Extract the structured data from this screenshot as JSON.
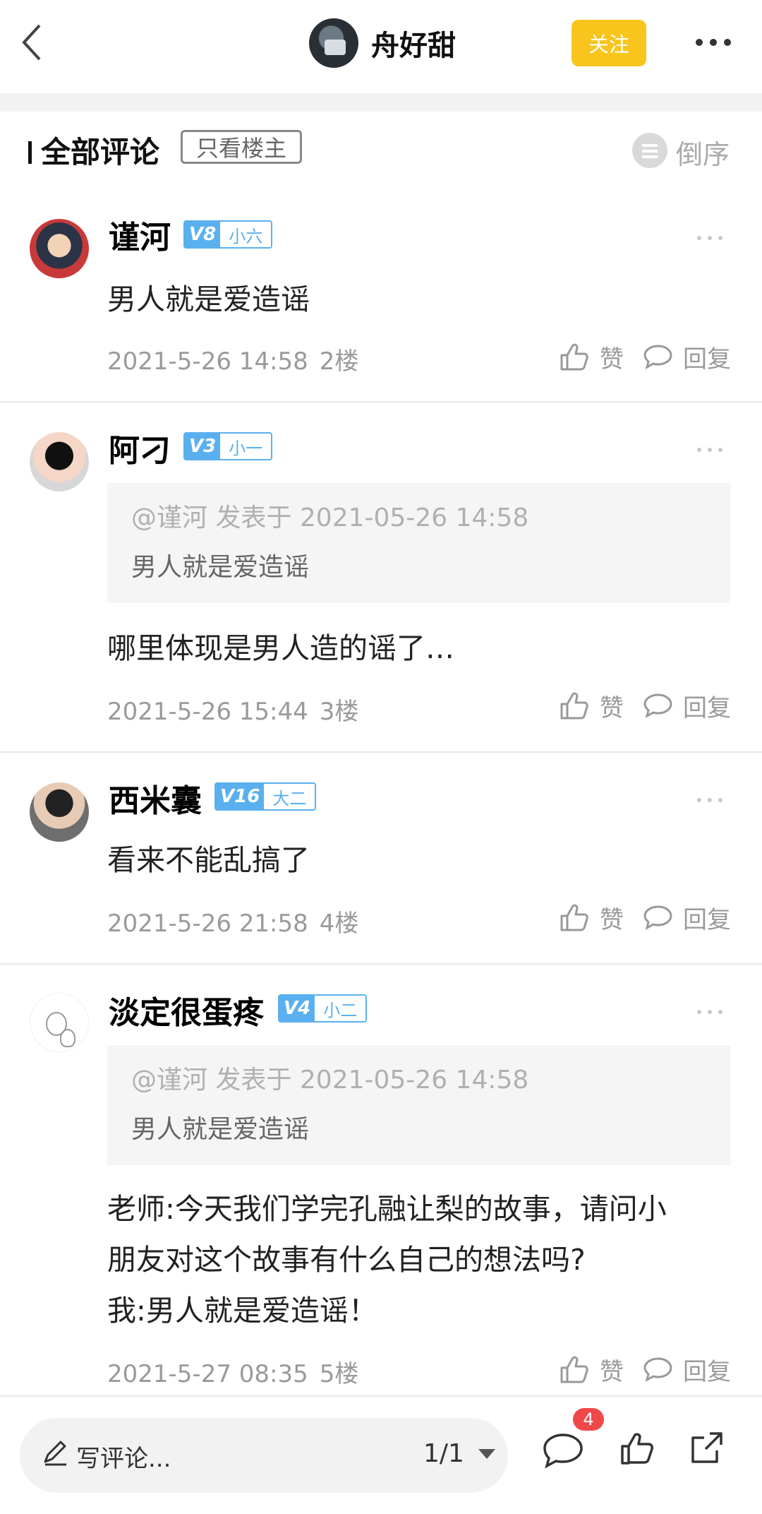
{
  "header": {
    "author_name": "舟好甜",
    "follow_label": "关注"
  },
  "comments_section": {
    "title": "全部评论",
    "owner_only_label": "只看楼主",
    "sort_label": "倒序"
  },
  "comments": [
    {
      "username": "谨河",
      "level": "V8",
      "rank": "小六",
      "content": [
        "男人就是爱造谣"
      ],
      "time": "2021-5-26 14:58",
      "floor": "2楼",
      "like_label": "赞",
      "reply_label": "回复"
    },
    {
      "username": "阿刁",
      "level": "V3",
      "rank": "小一",
      "quote": {
        "meta": "@谨河  发表于 2021-05-26 14:58",
        "text": "男人就是爱造谣"
      },
      "content": [
        "哪里体现是男人造的谣了…"
      ],
      "time": "2021-5-26 15:44",
      "floor": "3楼",
      "like_label": "赞",
      "reply_label": "回复"
    },
    {
      "username": "西米囊",
      "level": "V16",
      "rank": "大二",
      "content": [
        "看来不能乱搞了"
      ],
      "time": "2021-5-26 21:58",
      "floor": "4楼",
      "like_label": "赞",
      "reply_label": "回复"
    },
    {
      "username": "淡定很蛋疼",
      "level": "V4",
      "rank": "小二",
      "quote": {
        "meta": "@谨河  发表于 2021-05-26 14:58",
        "text": "男人就是爱造谣"
      },
      "content": [
        "老师:今天我们学完孔融让梨的故事，请问小",
        "朋友对这个故事有什么自己的想法吗?",
        "我:男人就是爱造谣！"
      ],
      "time": "2021-5-27 08:35",
      "floor": "5楼",
      "like_label": "赞",
      "reply_label": "回复"
    }
  ],
  "bottom_bar": {
    "placeholder": "写评论...",
    "page": "1/1",
    "comment_count": "4"
  },
  "colors": {
    "follow_button": "#f9c51c",
    "level_badge": "#5ab0ee",
    "count_badge": "#f04848"
  }
}
